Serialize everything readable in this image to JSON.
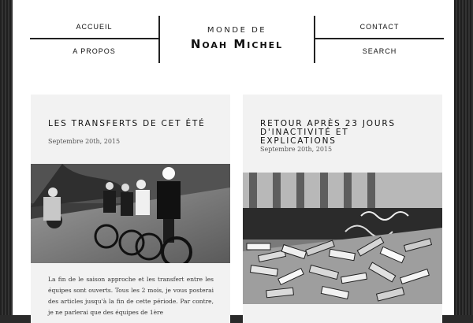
{
  "nav": {
    "left_top": "ACCUEIL",
    "left_bottom": "A PROPOS",
    "right_top": "CONTACT",
    "right_bottom": "SEARCH"
  },
  "brand": {
    "line1": "MONDE DE",
    "line2": "Noah Michel"
  },
  "posts": [
    {
      "title": "Les transferts de cet été",
      "date": "Septembre 20th, 2015",
      "excerpt": "La fin de le saison approche et les transfert entre les équipes sont ouverts. Tous les 2 mois, je vous posterai des articles jusqu'à la fin de cette période. Par contre, je ne parlerai que des équipes de 1ère"
    },
    {
      "title": "Retour après 23 jours d'inactivité et explications",
      "date": "Septembre 20th, 2015"
    }
  ]
}
